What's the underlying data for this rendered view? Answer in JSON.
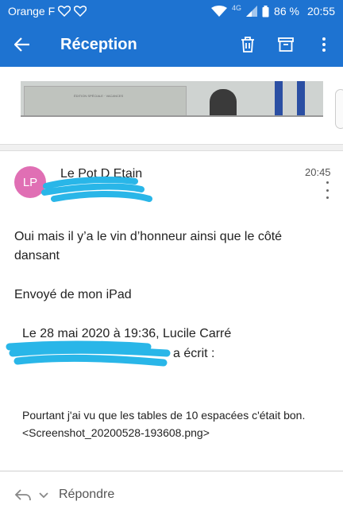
{
  "status": {
    "carrier": "Orange F",
    "network": "4G",
    "battery": "86 %",
    "clock": "20:55"
  },
  "appbar": {
    "title": "Réception"
  },
  "preview_card": {
    "image_caption": "ÉDITION SPÉCIALE · VACANCES"
  },
  "mail": {
    "avatar_initials": "LP",
    "avatar_color": "#e06fb4",
    "sender": "Le Pot D Etain",
    "time": "20:45",
    "body": "Oui mais il y’a le vin d’honneur ainsi que le côté dansant",
    "signature": "Envoyé de mon iPad",
    "quote_header": "Le 28 mai 2020 à 19:36, Lucile Carré",
    "quote_wrote": "a écrit :",
    "quote_body_1": "Pourtant j'ai vu que les tables de 10 espacées c'était bon.",
    "quote_body_2": "<Screenshot_20200528-193608.png>"
  },
  "reply": {
    "label": "Répondre"
  },
  "colors": {
    "accent": "#1e73d1",
    "redaction": "#29b6e8"
  }
}
